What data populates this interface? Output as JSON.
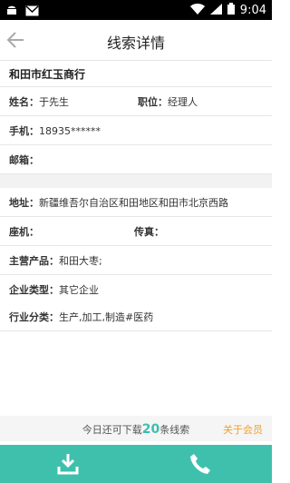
{
  "status": {
    "time": "9:04"
  },
  "header": {
    "title": "线索详情"
  },
  "company": {
    "name": "和田市红玉商行"
  },
  "contact": {
    "name_label": "姓名：",
    "name_value": "于先生",
    "position_label": "职位：",
    "position_value": "经理人",
    "phone_label": "手机：",
    "phone_value": "18935******",
    "email_label": "邮箱：",
    "email_value": ""
  },
  "details": {
    "address_label": "地址：",
    "address_value": "新疆维吾尔自治区和田地区和田市北京西路",
    "landline_label": "座机：",
    "landline_value": "",
    "fax_label": "传真：",
    "fax_value": "",
    "products_label": "主营产品：",
    "products_value": "和田大枣;",
    "type_label": "企业类型：",
    "type_value": "其它企业",
    "industry_label": "行业分类：",
    "industry_value": "生产,加工,制造#医药"
  },
  "footer": {
    "prefix": "今日还可下载",
    "count": "20",
    "suffix": "条线索",
    "vip_link": "关于会员"
  },
  "icons": {
    "back": "arrow-left-icon",
    "download": "download-icon",
    "phone": "phone-icon",
    "android": "android-icon",
    "mail": "mail-icon",
    "wifi": "wifi-icon",
    "signal": "signal-icon",
    "battery": "battery-icon"
  },
  "colors": {
    "accent": "#3fc0ad",
    "vip": "#f0a030"
  }
}
